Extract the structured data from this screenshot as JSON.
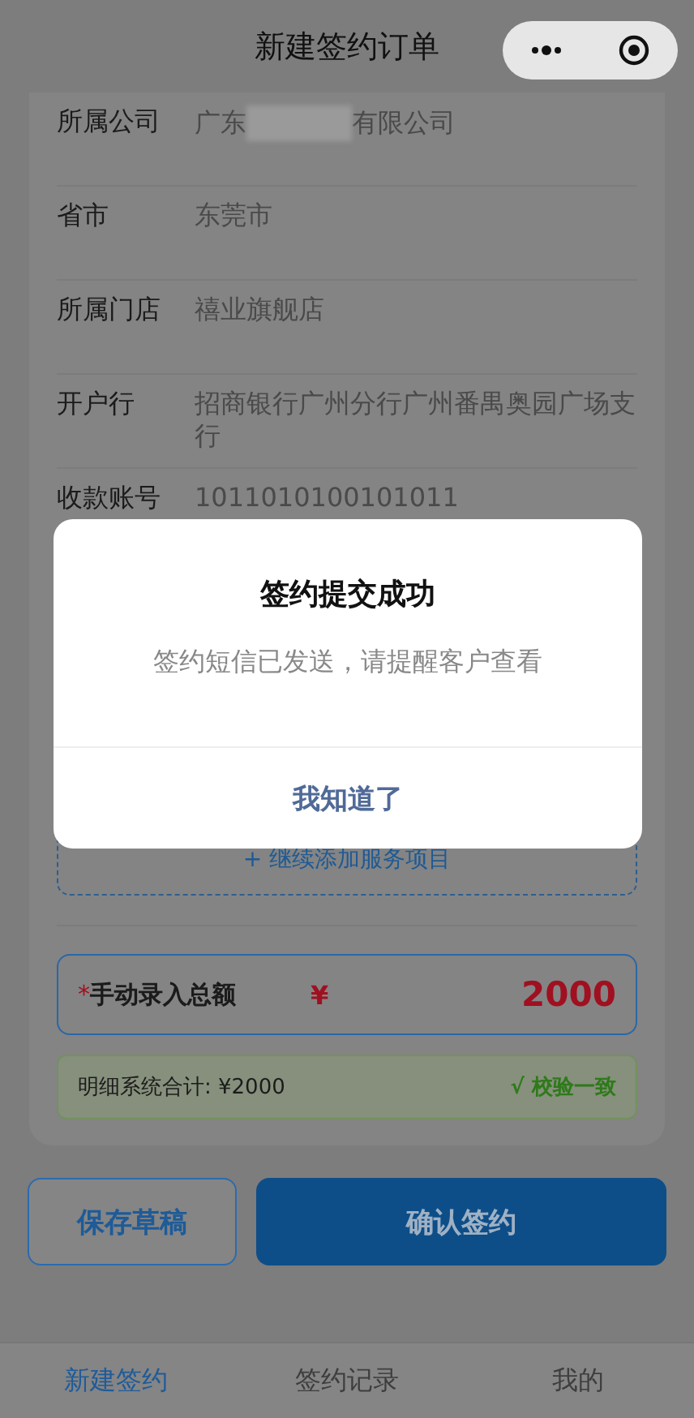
{
  "header": {
    "title": "新建签约订单"
  },
  "fields": [
    {
      "label": "所属公司",
      "value": "广东",
      "value_after": "有限公司",
      "redacted": true
    },
    {
      "label": "省市",
      "value": "东莞市",
      "redacted": false
    },
    {
      "label": "所属门店",
      "value": "禧业旗舰店",
      "redacted": false
    },
    {
      "label": "开户行",
      "value": "招商银行广州分行广州番禺奥园广场支行",
      "redacted": false
    },
    {
      "label": "收款账号",
      "value": "1011010100101011",
      "redacted": false
    }
  ],
  "add_service": {
    "label": "+ 继续添加服务项目"
  },
  "amount": {
    "required_mark": "*",
    "label": "手动录入总额",
    "currency": "¥",
    "value": "2000"
  },
  "summary": {
    "text": "明细系统合计: ¥2000",
    "status": "√ 校验一致"
  },
  "actions": [
    {
      "label": "保存草稿",
      "kind": "outline"
    },
    {
      "label": "确认签约",
      "kind": "primary"
    }
  ],
  "tabs": [
    {
      "label": "新建签约",
      "selected": true
    },
    {
      "label": "签约记录",
      "selected": false
    },
    {
      "label": "我的",
      "selected": false
    }
  ],
  "dialog": {
    "title": "签约提交成功",
    "message": "签约短信已发送，请提醒客户查看",
    "button": "我知道了"
  }
}
